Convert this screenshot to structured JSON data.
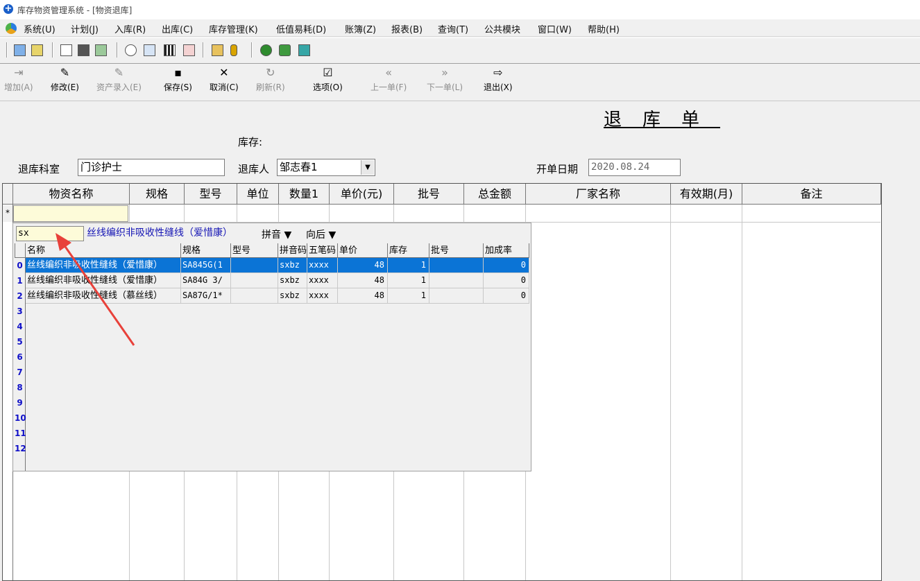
{
  "window": {
    "title": "库存物资管理系统 - [物资退库]"
  },
  "menubar": {
    "items": [
      "系统(U)",
      "计划(J)",
      "入库(R)",
      "出库(C)",
      "库存管理(K)",
      "低值易耗(D)",
      "账簿(Z)",
      "报表(B)",
      "查询(T)",
      "公共模块",
      "窗口(W)",
      "帮助(H)"
    ]
  },
  "toolbar_actions": [
    {
      "symbol": "⇥",
      "label": "增加(A)",
      "enabled": false
    },
    {
      "symbol": "✎",
      "label": "修改(E)",
      "enabled": true
    },
    {
      "symbol": "✎",
      "label": "资产录入(E)",
      "enabled": false
    },
    {
      "symbol": "▪",
      "label": "保存(S)",
      "enabled": true
    },
    {
      "symbol": "✕",
      "label": "取消(C)",
      "enabled": true
    },
    {
      "symbol": "↻",
      "label": "刷新(R)",
      "enabled": false
    },
    {
      "symbol": "☑",
      "label": "选项(O)",
      "enabled": true
    },
    {
      "symbol": "«",
      "label": "上一单(F)",
      "enabled": false
    },
    {
      "symbol": "»",
      "label": "下一单(L)",
      "enabled": false
    },
    {
      "symbol": "⇨",
      "label": "退出(X)",
      "enabled": true
    }
  ],
  "form": {
    "doc_title": "退库单",
    "stock_label": "库存:",
    "dept_label": "退库科室",
    "dept_value": "门诊护士",
    "person_label": "退库人",
    "person_value": "邹志春1",
    "date_label": "开单日期",
    "date_value": "2020.08.24"
  },
  "grid": {
    "columns": [
      "物资名称",
      "规格",
      "型号",
      "单位",
      "数量1",
      "单价(元)",
      "批号",
      "总金额",
      "厂家名称",
      "有效期(月)",
      "备注"
    ],
    "new_row_marker": "*"
  },
  "lookup": {
    "search_value": "sx",
    "selected_name": "丝线编织非吸收性缝线（爱惜康）",
    "mode_label": "拼音",
    "direction_label": "向后",
    "columns": [
      "名称",
      "规格",
      "型号",
      "拼音码",
      "五笔码",
      "单价",
      "库存",
      "批号",
      "加成率"
    ],
    "rows": [
      {
        "name": "丝线编织非吸收性缝线（爱惜康）",
        "spec": "SA845G(1",
        "model": "",
        "pinyin": "sxbz",
        "wubi": "xxxx",
        "price": "48",
        "stock": "1",
        "batch": "",
        "markup": "0"
      },
      {
        "name": "丝线编织非吸收性缝线（爱惜康）",
        "spec": "SA84G 3/",
        "model": "",
        "pinyin": "sxbz",
        "wubi": "xxxx",
        "price": "48",
        "stock": "1",
        "batch": "",
        "markup": "0"
      },
      {
        "name": "丝线编织非吸收性缝线（慕丝线）",
        "spec": "SA87G/1*",
        "model": "",
        "pinyin": "sxbz",
        "wubi": "xxxx",
        "price": "48",
        "stock": "1",
        "batch": "",
        "markup": "0"
      }
    ],
    "row_numbers": [
      "0",
      "1",
      "2",
      "3",
      "4",
      "5",
      "6",
      "7",
      "8",
      "9",
      "10",
      "11",
      "12"
    ]
  },
  "colors": {
    "selection": "#0b74d6",
    "annotation_arrow": "#e8413a",
    "highlight_text": "#1414b4"
  }
}
